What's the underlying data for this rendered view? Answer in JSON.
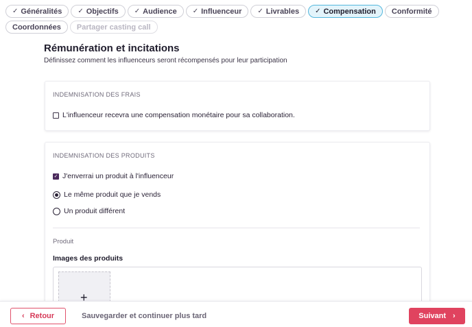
{
  "steps": [
    {
      "label": "Généralités",
      "check": "✓"
    },
    {
      "label": "Objectifs",
      "check": "✓"
    },
    {
      "label": "Audience",
      "check": "✓"
    },
    {
      "label": "Influenceur",
      "check": "✓"
    },
    {
      "label": "Livrables",
      "check": "✓"
    },
    {
      "label": "Compensation",
      "check": "✓"
    },
    {
      "label": "Conformité"
    },
    {
      "label": "Coordonnées"
    },
    {
      "label": "Partager casting call"
    }
  ],
  "header": {
    "title": "Rémunération et incitations",
    "subtitle": "Définissez comment les influenceurs seront récompensés pour leur participation"
  },
  "frais": {
    "section_label": "INDEMNISATION DES FRAIS",
    "checkbox_label": "L'influenceur recevra une compensation monétaire pour sa collaboration.",
    "checked": false
  },
  "produits": {
    "section_label": "INDEMNISATION DES PRODUITS",
    "checkbox_label": "J'enverrai un produit à l'influenceur",
    "checked": true,
    "radio_same": "Le même produit que je vends",
    "radio_different": "Un produit différent",
    "selected": "same",
    "produit_label": "Produit",
    "images_label": "Images des produits",
    "upload_icon": "+"
  },
  "footer": {
    "back_label": "Retour",
    "back_icon": "‹",
    "save_later_label": "Sauvegarder et continuer plus tard",
    "next_label": "Suivant",
    "next_icon": "›"
  },
  "colors": {
    "accent": "#e0435f",
    "active_step_bg": "#e3f4fb",
    "active_step_border": "#52b6dc",
    "checkbox_checked": "#4b2a5c"
  }
}
